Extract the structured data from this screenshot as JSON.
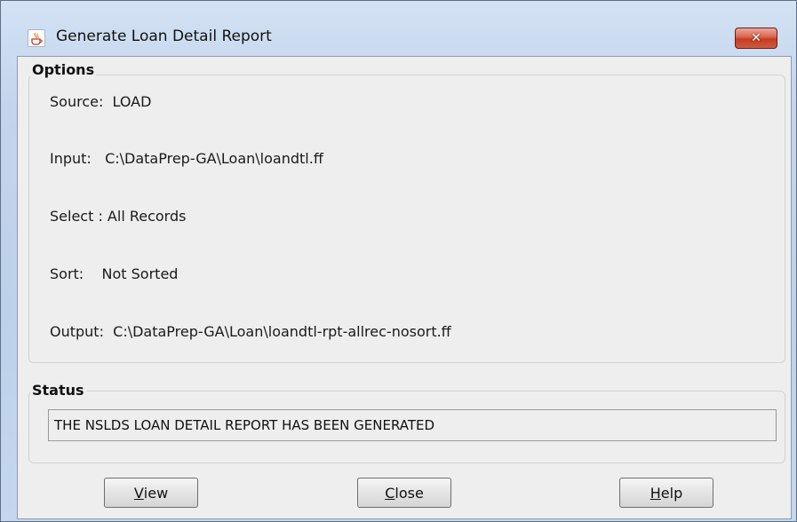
{
  "window": {
    "title": "Generate Loan Detail Report",
    "close_glyph": "✕",
    "icon": "java-cup-icon"
  },
  "options": {
    "legend": "Options",
    "source": "Source:  LOAD",
    "input": "Input:   C:\\DataPrep-GA\\Loan\\loandtl.ff",
    "select": "Select : All Records",
    "sort": "Sort:    Not Sorted",
    "output": "Output:  C:\\DataPrep-GA\\Loan\\loandtl-rpt-allrec-nosort.ff"
  },
  "status": {
    "legend": "Status",
    "message": "THE NSLDS LOAN DETAIL REPORT HAS BEEN GENERATED"
  },
  "buttons": {
    "view": {
      "mnemonic": "V",
      "rest": "iew"
    },
    "close": {
      "mnemonic": "C",
      "rest": "lose"
    },
    "help": {
      "mnemonic": "H",
      "rest": "elp"
    }
  },
  "colors": {
    "title_bar": "#c3d5ec",
    "client_bg": "#eeeeee",
    "close_button": "#c43b22"
  }
}
